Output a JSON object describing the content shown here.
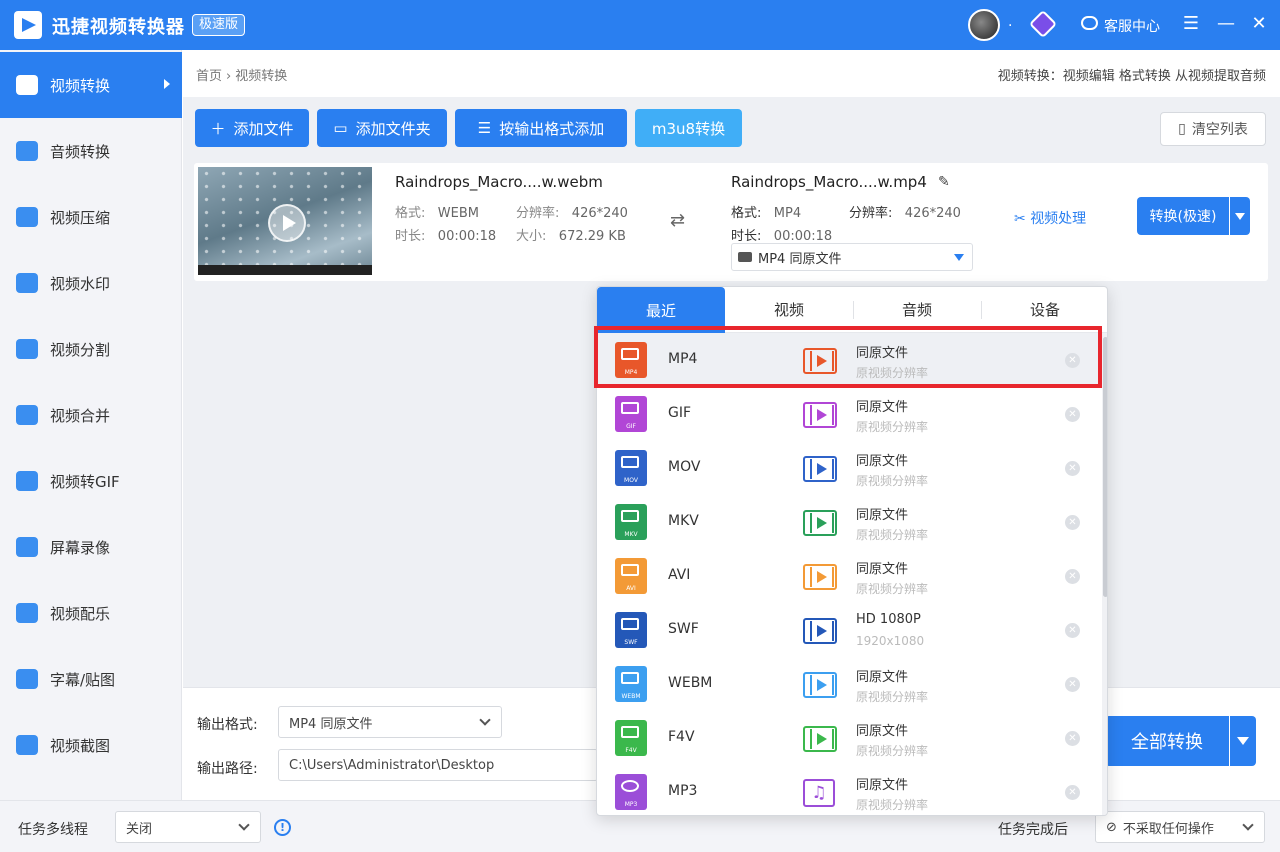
{
  "app": {
    "title": "迅捷视频转换器",
    "badge": "极速版",
    "user_dot": ".",
    "service_label": "客服中心",
    "win_menu": "☰",
    "win_minimize": "—",
    "win_close": "✕"
  },
  "sidebar": {
    "items": [
      {
        "label": "视频转换"
      },
      {
        "label": "音频转换"
      },
      {
        "label": "视频压缩"
      },
      {
        "label": "视频水印"
      },
      {
        "label": "视频分割"
      },
      {
        "label": "视频合并"
      },
      {
        "label": "视频转GIF"
      },
      {
        "label": "屏幕录像"
      },
      {
        "label": "视频配乐"
      },
      {
        "label": "字幕/贴图"
      },
      {
        "label": "视频截图"
      }
    ]
  },
  "breadcrumb": {
    "home": "首页",
    "separator": "›",
    "current": "视频转换"
  },
  "top_hint": "视频转换：视频编辑 格式转换 从视频提取音频",
  "toolbar": {
    "add_file": "添加文件",
    "add_folder": "添加文件夹",
    "add_by_format": "按输出格式添加",
    "m3u8": "m3u8转换",
    "clear_list": "清空列表"
  },
  "file": {
    "input_name": "Raindrops_Macro....w.webm",
    "format_label": "格式:",
    "format_value": "WEBM",
    "resolution_label": "分辨率:",
    "resolution_value": "426*240",
    "duration_label": "时长:",
    "duration_value": "00:00:18",
    "size_label": "大小:",
    "size_value": "672.29 KB",
    "output_name": "Raindrops_Macro....w.mp4",
    "output_format_label": "格式:",
    "output_format_value": "MP4",
    "output_resolution_label": "分辨率:",
    "output_resolution_value": "426*240",
    "output_duration_label": "时长:",
    "output_duration_value": "00:00:18",
    "output_select": "MP4  同原文件",
    "video_process": "视频处理",
    "convert_button": "转换(极速)"
  },
  "popup": {
    "tabs": [
      "最近",
      "视频",
      "音频",
      "设备"
    ],
    "rows": [
      {
        "format": "MP4",
        "tag": "MP4",
        "color": "#e8572a",
        "quality": "同原文件",
        "desc": "原视频分辨率"
      },
      {
        "format": "GIF",
        "tag": "GIF",
        "color": "#b146d6",
        "quality": "同原文件",
        "desc": "原视频分辨率"
      },
      {
        "format": "MOV",
        "tag": "MOV",
        "color": "#2f63c9",
        "quality": "同原文件",
        "desc": "原视频分辨率"
      },
      {
        "format": "MKV",
        "tag": "MKV",
        "color": "#2aa05a",
        "quality": "同原文件",
        "desc": "原视频分辨率"
      },
      {
        "format": "AVI",
        "tag": "AVI",
        "color": "#f39a36",
        "quality": "同原文件",
        "desc": "原视频分辨率"
      },
      {
        "format": "SWF",
        "tag": "SWF",
        "color": "#2458b8",
        "quality": "HD 1080P",
        "desc": "1920x1080"
      },
      {
        "format": "WEBM",
        "tag": "WEBM",
        "color": "#3c9ff0",
        "quality": "同原文件",
        "desc": "原视频分辨率"
      },
      {
        "format": "F4V",
        "tag": "F4V",
        "color": "#3bb84c",
        "quality": "同原文件",
        "desc": "原视频分辨率"
      },
      {
        "format": "MP3",
        "tag": "MP3",
        "color": "#9b4ed8",
        "quality": "同原文件",
        "desc": "原视频分辨率"
      }
    ]
  },
  "bottom": {
    "output_format_label": "输出格式:",
    "output_format_value": "MP4  同原文件",
    "output_path_label": "输出路径:",
    "output_path_value": "C:\\Users\\Administrator\\Desktop",
    "convert_all": "全部转换"
  },
  "statusbar": {
    "multithread_label": "任务多线程",
    "multithread_value": "关闭",
    "info_icon": "!",
    "after_label": "任务完成后",
    "after_value": "不采取任何操作"
  },
  "colors": {
    "accent": "#2a7ff0",
    "highlight_box": "#e8262d"
  }
}
